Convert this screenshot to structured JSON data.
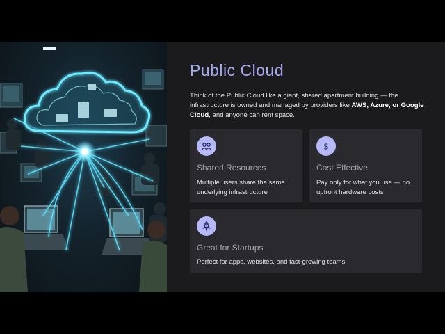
{
  "slide": {
    "title": "Public Cloud",
    "intro": {
      "before": "Think of the Public Cloud like a giant, shared apartment building — the infrastructure is owned and managed by providers like ",
      "bold1": "AWS, Azure, or Google Cloud",
      "after": ", and anyone can rent space."
    },
    "cards": [
      {
        "icon": "users-icon",
        "title": "Shared Resources",
        "desc_line1": "Multiple users share the same",
        "desc_line2": "underlying infrastructure"
      },
      {
        "icon": "dollar-icon",
        "title": "Cost Effective",
        "desc_line1": "Pay only for what you use — no",
        "desc_line2": "upfront hardware costs"
      },
      {
        "icon": "rocket-icon",
        "title": "Great for Startups",
        "desc_line1": "Perfect for apps, websites, and fast-growing teams"
      }
    ]
  },
  "colors": {
    "title": "#a6a8f2",
    "icon_circle": "#b7b9f6",
    "card_bg": "#2a2a2e",
    "slide_bg": "#1b1b1d",
    "glow": "#5fe3ff"
  },
  "illustration": {
    "subject": "glowing cloud network connecting many people working at laptops"
  }
}
